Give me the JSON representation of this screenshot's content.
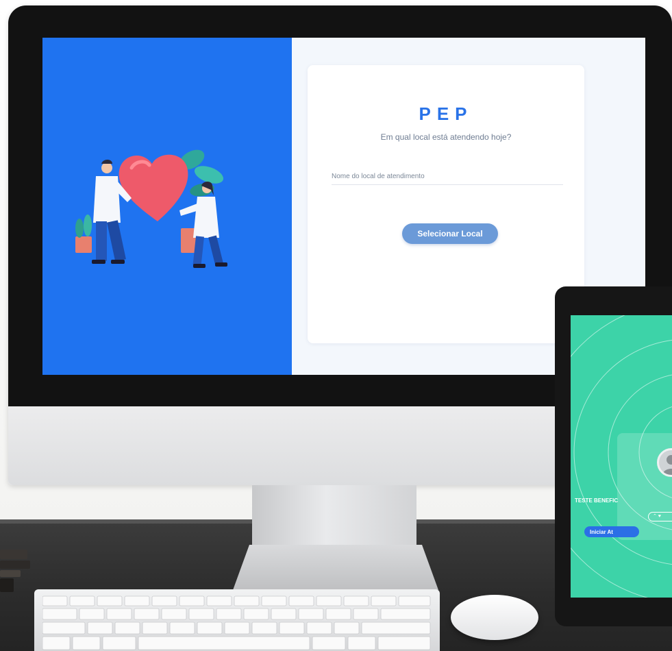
{
  "desktop_app": {
    "brand": "PEP",
    "subtitle": "Em qual local está atendendo hoje?",
    "location_placeholder": "Nome do local de atendimento",
    "select_button": "Selecionar Local"
  },
  "tablet_app": {
    "patient_name": "TESTE BENEFIC",
    "status_pill": "⌃ ♥",
    "start_button": "Iniciar At"
  },
  "colors": {
    "brand_blue": "#2a73e8",
    "hero_blue": "#1f73f0",
    "button_blue": "#6b9ad8",
    "tablet_green": "#3dd3a8"
  }
}
